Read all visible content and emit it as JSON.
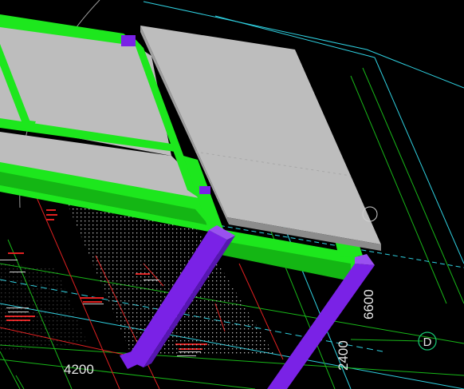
{
  "viewport": {
    "background": "#000000",
    "colors": {
      "beam": "#1de71d",
      "beam_dark": "#14b614",
      "column": "#7a22e6",
      "column_dark": "#5616b0",
      "slab": "#bdbdbd",
      "slab_edge": "#8c8c8c",
      "cad_cyan": "#2fd0e0",
      "cad_green": "#18b618",
      "cad_red": "#e02020",
      "axis_circle": "#18c070"
    }
  },
  "dimensions": {
    "d4200": "4200",
    "d6600": "6600",
    "d2400": "2400"
  },
  "axis_labels": {
    "d": "D"
  }
}
